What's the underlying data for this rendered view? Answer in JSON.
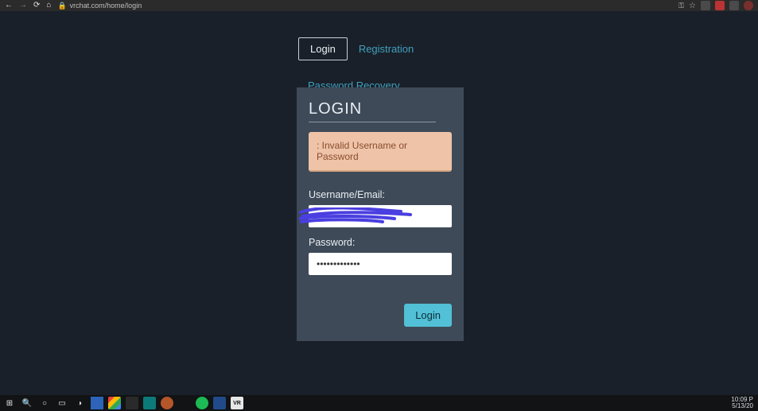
{
  "browser": {
    "url": "vrchat.com/home/login"
  },
  "tabs": {
    "login": "Login",
    "registration": "Registration",
    "password_recovery": "Password Recovery"
  },
  "panel": {
    "title": "LOGIN",
    "error": ": Invalid Username or Password",
    "username_label": "Username/Email:",
    "username_value": "",
    "password_label": "Password:",
    "password_value": "•••••••••••••",
    "login_button": "Login"
  },
  "taskbar": {
    "time": "10:09 P",
    "date": "5/13/20"
  }
}
